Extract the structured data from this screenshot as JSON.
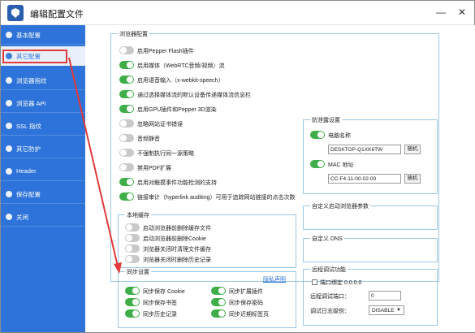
{
  "window": {
    "title": "编辑配置文件"
  },
  "sidebar": {
    "items": [
      {
        "label": "基本配置"
      },
      {
        "label": "其它配置"
      },
      {
        "label": "浏览器指纹"
      },
      {
        "label": "浏览器 API"
      },
      {
        "label": "SSL 指纹"
      },
      {
        "label": "其它防护"
      },
      {
        "label": "Header"
      },
      {
        "label": "保存配置"
      },
      {
        "label": "关闭"
      }
    ]
  },
  "browser_config": {
    "title": "浏览器配置",
    "options": [
      {
        "label": "启用Pepper Flash插件",
        "on": false
      },
      {
        "label": "启用媒体（WebRTC音频/视频）流",
        "on": true
      },
      {
        "label": "启用语音输入（x-webkit-speech）",
        "on": true
      },
      {
        "label": "通过选择媒体流的默认设备传递媒体流信息栏",
        "on": true
      },
      {
        "label": "启用GPU插件和Pepper 3D渲染",
        "on": true
      },
      {
        "label": "忽略网站证书错误",
        "on": false
      },
      {
        "label": "音频静音",
        "on": false
      },
      {
        "label": "不强制执行同一源策略",
        "on": false
      },
      {
        "label": "禁用PDF扩展",
        "on": false
      },
      {
        "label": "启用对触摸事件功能检测的支持",
        "on": true
      },
      {
        "label": "链接审计（hyperlink auditing）可用于追踪网站链接的点击次数",
        "on": true
      }
    ]
  },
  "anti_leak": {
    "title": "防泄露设置",
    "computer_name_label": "电脑名称",
    "computer_name_value": "DESKTOP-Q1XK6TW",
    "computer_name_on": true,
    "mac_label": "MAC 地址",
    "mac_value": "CC-F4-11-00-02-00",
    "mac_on": true,
    "random_button": "随机"
  },
  "local_cache": {
    "title": "本地缓存",
    "options": [
      {
        "label": "启动浏览器前删除缓存文件",
        "on": false
      },
      {
        "label": "启动浏览器前删除Cookie",
        "on": false
      },
      {
        "label": "浏览器关闭时清理文件缓存",
        "on": false
      },
      {
        "label": "浏览器关闭时删除历史记录",
        "on": false
      }
    ]
  },
  "custom_params": {
    "title": "自定义启动浏览器参数"
  },
  "custom_dns": {
    "title": "自定义 DNS"
  },
  "sync": {
    "title": "同步设置",
    "privacy_link": "隐私声明",
    "options": [
      {
        "label": "同步保存 Cookie",
        "on": true
      },
      {
        "label": "同步扩展插件",
        "on": true
      },
      {
        "label": "同步保存书签",
        "on": true
      },
      {
        "label": "同步保存密码",
        "on": true
      },
      {
        "label": "同步历史记录",
        "on": true
      },
      {
        "label": "同步近期标签页",
        "on": true
      }
    ]
  },
  "remote_debug": {
    "title": "远程调试功能",
    "bind_label": "端口绑定 0.0.0.0",
    "port_label": "远程调试端口：",
    "port_value": "0",
    "log_label": "调试日志级别：",
    "log_value": "DISABLE"
  },
  "colors": {
    "accent": "#2d73d9",
    "toggle_on": "#3fae49",
    "toggle_off": "#c9c9c9",
    "annotation": "#e23a3a"
  }
}
